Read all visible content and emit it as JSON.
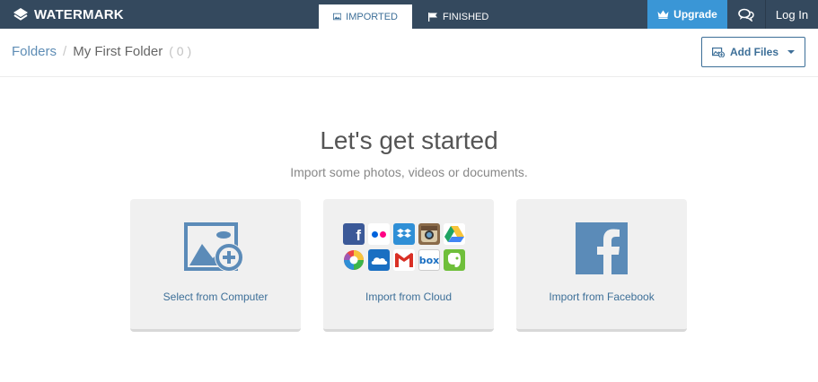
{
  "app": {
    "logo_text": "WATERMARK"
  },
  "nav": {
    "tabs": [
      {
        "label": "IMPORTED",
        "active": true
      },
      {
        "label": "FINISHED",
        "active": false
      }
    ],
    "upgrade_label": "Upgrade",
    "login_label": "Log In"
  },
  "breadcrumb": {
    "root": "Folders",
    "separator": "/",
    "current": "My First Folder",
    "count": "( 0 )"
  },
  "toolbar": {
    "add_files_label": "Add Files"
  },
  "main": {
    "title": "Let's get started",
    "subtitle": "Import some photos, videos or documents.",
    "cards": [
      {
        "label": "Select from Computer",
        "icon": "image-add-icon"
      },
      {
        "label": "Import from Cloud",
        "icon": "cloud-services-icon"
      },
      {
        "label": "Import from Facebook",
        "icon": "facebook-icon"
      }
    ],
    "cloud_services": [
      {
        "name": "facebook-icon",
        "glyph": "f",
        "color": "#3b5998"
      },
      {
        "name": "flickr-icon",
        "glyph": "",
        "color": "#ffffff"
      },
      {
        "name": "dropbox-icon",
        "glyph": "",
        "color": "#2f8fd6"
      },
      {
        "name": "instagram-icon",
        "glyph": "",
        "color": "#8a6b4a"
      },
      {
        "name": "google-drive-icon",
        "glyph": "",
        "color": "#ffffff"
      },
      {
        "name": "picasa-icon",
        "glyph": "",
        "color": "#ffffff"
      },
      {
        "name": "onedrive-icon",
        "glyph": "",
        "color": "#1a6fc2"
      },
      {
        "name": "gmail-icon",
        "glyph": "M",
        "color": "#ffffff"
      },
      {
        "name": "box-icon",
        "glyph": "box",
        "color": "#ffffff"
      },
      {
        "name": "evernote-icon",
        "glyph": "",
        "color": "#6fbf3b"
      }
    ]
  },
  "colors": {
    "topbar": "#34495e",
    "accent": "#3a96d6",
    "link": "#3d6f98",
    "card_bg": "#f0f0f0"
  }
}
